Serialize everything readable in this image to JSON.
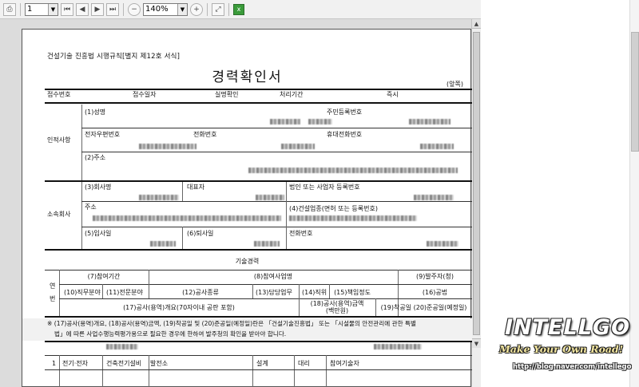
{
  "toolbar": {
    "page_number": "1",
    "zoom": "140%"
  },
  "form": {
    "law_reference": "건설기술 진흥법 시행규칙[별지 제12호 서식]",
    "title": "경력확인서",
    "front_back": "(앞쪽)",
    "receipt_header": {
      "receipt_no": "접수번호",
      "receipt_date": "접수일자",
      "real_name_check": "실명확인",
      "processing_period": "처리기간",
      "immediate": "즉시"
    },
    "personal": {
      "section_label": "인적사항",
      "name": "(1)성명",
      "resident_no": "주민등록번호",
      "email": "전자우편번호",
      "phone": "전화번호",
      "mobile": "휴대전화번호",
      "address": "(2)주소"
    },
    "company": {
      "section_label": "소속회사",
      "company_name": "(3)회사명",
      "ceo": "대표자",
      "corp_reg_no": "법인 또는 사업자 등록번호",
      "address": "주소",
      "business_type": "(4)건설업종(면허 또는 등록번호)",
      "join_date": "(5)입사일",
      "leave_date": "(6)퇴사일",
      "phone": "전화번호"
    },
    "career": {
      "section_title": "기술경력",
      "side_label_1": "연",
      "side_label_2": "번",
      "participation_period": "(7)참여기간",
      "project_name": "(8)참여사업명",
      "client": "(9)발주자(청)",
      "field": "(10)직무분야",
      "specialty": "(11)전문분야",
      "work_type": "(12)공사종류",
      "duty": "(13)담당업무",
      "position": "(14)직위",
      "responsibility": "(15)책임정도",
      "method": "(16)공법",
      "overview": "(17)공사(용역)개요(70자이내 공란 포함)",
      "amount_line1": "(18)공사(용역)금액",
      "amount_line2": "(백만원)",
      "completion": "(19)착공일 (20)준공일(예정일)"
    },
    "note_line1": "※ (17)공사(용역)개요, (18)공사(용역)금액, (19)착공일 및 (20)준공일(예정일)란은 「건설기술진흥법」 또는 「시설물의 안전관리에 관한 특별",
    "note_line2": "법」에 따른 사업수행능력평가용으로 필요한 경우에 한하여 발주청의 확인을 받아야 합니다.",
    "row1": {
      "no": "1",
      "field": "전기·전자",
      "specialty": "건축전기설비",
      "work_type": "발전소",
      "duty": "설계",
      "position": "대리",
      "responsibility": "참여기술자"
    }
  },
  "watermark": {
    "brand": "INTELLGO",
    "slogan": "Make Your Own Road!",
    "url": "http://blog.naver.com/intellego"
  }
}
